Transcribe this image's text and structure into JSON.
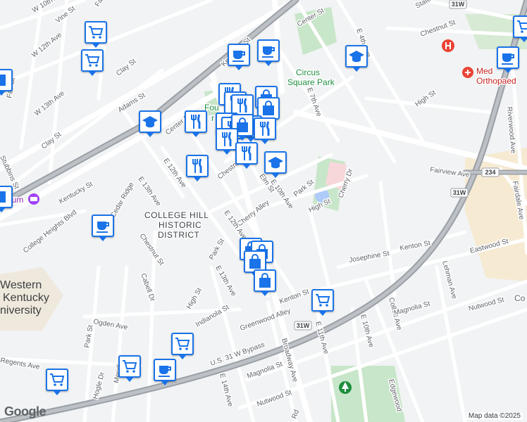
{
  "map": {
    "attribution": "Map data ©2025",
    "logo": "Google",
    "district_label_line1": "COLLEGE HILL",
    "district_label_line2": "HISTORIC",
    "district_label_line3": "DISTRICT",
    "park_label_line1": "Circus",
    "park_label_line2": "Square Park",
    "park_partial_label_line1": "Fou",
    "park_partial_label_line2": "r",
    "campus_label_line1": "Western",
    "campus_label_line2": "Kentucky",
    "campus_label_line3": "niversity",
    "museum_label": "eum",
    "hospital_label_line1": "Med",
    "hospital_label_line2": "Orthopaed",
    "partial_right_label": "Co",
    "shields": [
      "31W",
      "31W",
      "234",
      "31W"
    ],
    "colors": {
      "marker_border": "#1a73e8",
      "park": "#c8e6c9",
      "campus": "#f6ead3",
      "highway": "#9aa0a6",
      "major_road": "#ffffff",
      "hospital": "#ea4335"
    }
  },
  "roads": [
    "W 10th Ave",
    "Vine St",
    "W 12th Ave",
    "Clay St",
    "Adams St",
    "Kentucky St",
    "W 13th Ave",
    "Fair St",
    "Clay St",
    "Center St",
    "E 12th Ave",
    "E 13th Ave",
    "Chestnut St",
    "Elm St",
    "E 10th Ave",
    "Park St",
    "College Heights Blvd",
    "Cherry Alley",
    "E 12th Ave",
    "Park St",
    "E 13th Ave",
    "Chestnut St",
    "Cabell Dr",
    "High St",
    "Indianola St",
    "Ogden Ave",
    "Park St",
    "Hogle Dr",
    "Greenwood Alley",
    "U.S. 31 W Bypass",
    "E 14th Ave",
    "Regents Ave",
    "Meridian",
    "Magnolia St",
    "Nutwood St",
    "Broadway Ave",
    "E 11th Ave",
    "Kenton St",
    "Josephine St",
    "High St",
    "Cherry Dr",
    "E 10th Ave",
    "Collett Ave",
    "Magnolia St",
    "Nutwood St",
    "Edgewood",
    "Kenton St",
    "Eastwood St",
    "Lehman Ave",
    "Fairview Ave",
    "Riverwood Ave",
    "Fairdale Ave",
    "High St",
    "E 7th Ave",
    "E 4th Ave",
    "Chestnut St",
    "Center St",
    "State St",
    "Fa",
    "E 12th",
    "Stubbins St",
    "Kentucky St",
    "Cedar Ridge",
    "Rd"
  ],
  "markers": [
    {
      "type": "grocery",
      "icon": "shopping-cart-icon"
    },
    {
      "type": "grocery",
      "icon": "shopping-cart-icon"
    },
    {
      "type": "cafe",
      "icon": "coffee-cup-icon"
    },
    {
      "type": "cafe",
      "icon": "coffee-cup-icon"
    },
    {
      "type": "school",
      "icon": "graduation-cap-icon"
    },
    {
      "type": "cafe",
      "icon": "coffee-cup-icon"
    },
    {
      "type": "grocery",
      "icon": "shopping-cart-icon"
    },
    {
      "type": "school",
      "icon": "graduation-cap-icon"
    },
    {
      "type": "restaurant",
      "icon": "fork-knife-icon"
    },
    {
      "type": "restaurant",
      "icon": "fork-knife-icon"
    },
    {
      "type": "restaurant",
      "icon": "fork-knife-icon"
    },
    {
      "type": "restaurant",
      "icon": "fork-knife-icon"
    },
    {
      "type": "shop",
      "icon": "shopping-bag-icon"
    },
    {
      "type": "shop",
      "icon": "shopping-bag-icon"
    },
    {
      "type": "restaurant",
      "icon": "fork-knife-icon"
    },
    {
      "type": "restaurant",
      "icon": "fork-knife-icon"
    },
    {
      "type": "restaurant",
      "icon": "fork-knife-icon"
    },
    {
      "type": "shop",
      "icon": "shopping-bag-icon"
    },
    {
      "type": "restaurant",
      "icon": "fork-knife-icon"
    },
    {
      "type": "restaurant",
      "icon": "fork-knife-icon"
    },
    {
      "type": "restaurant",
      "icon": "fork-knife-icon"
    },
    {
      "type": "school",
      "icon": "graduation-cap-icon"
    },
    {
      "type": "restaurant",
      "icon": "fork-knife-icon"
    },
    {
      "type": "cafe",
      "icon": "coffee-cup-icon"
    },
    {
      "type": "shop",
      "icon": "shopping-bag-icon"
    },
    {
      "type": "shop",
      "icon": "shopping-bag-icon"
    },
    {
      "type": "shop",
      "icon": "shopping-bag-icon"
    },
    {
      "type": "shop",
      "icon": "shopping-bag-icon"
    },
    {
      "type": "grocery",
      "icon": "shopping-cart-icon"
    },
    {
      "type": "grocery",
      "icon": "shopping-cart-icon"
    },
    {
      "type": "grocery",
      "icon": "shopping-cart-icon"
    },
    {
      "type": "cafe",
      "icon": "coffee-cup-icon"
    },
    {
      "type": "grocery",
      "icon": "shopping-cart-icon"
    },
    {
      "type": "grocery",
      "icon": "shopping-cart-icon"
    },
    {
      "type": "cafe",
      "icon": "coffee-cup-icon"
    },
    {
      "type": "shop",
      "icon": "shopping-bag-icon"
    },
    {
      "type": "partial",
      "icon": "map-marker-icon"
    }
  ]
}
